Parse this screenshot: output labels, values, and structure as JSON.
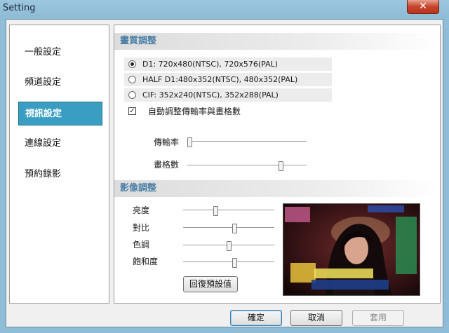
{
  "window": {
    "title": "Setting",
    "close_glyph": "✕"
  },
  "sidebar": {
    "items": [
      {
        "label": "一般設定",
        "active": false
      },
      {
        "label": "頻道設定",
        "active": false
      },
      {
        "label": "視訊設定",
        "active": true
      },
      {
        "label": "連線設定",
        "active": false
      },
      {
        "label": "預約錄影",
        "active": false
      }
    ]
  },
  "quality": {
    "header": "畫質調整",
    "options": [
      {
        "label": "D1: 720x480(NTSC), 720x576(PAL)",
        "selected": true
      },
      {
        "label": "HALF D1:480x352(NTSC), 480x352(PAL)",
        "selected": false
      },
      {
        "label": "CIF: 352x240(NTSC), 352x288(PAL)",
        "selected": false
      }
    ],
    "auto_adjust_label": "自動調整傳輸率與畫格數",
    "auto_adjust_checked": true,
    "auto_adjust_glyph": "✓",
    "sliders": [
      {
        "label": "傳輸率",
        "value": 0.0
      },
      {
        "label": "畫格數",
        "value": 0.8
      }
    ]
  },
  "image": {
    "header": "影像調整",
    "sliders": [
      {
        "label": "亮度",
        "value": 0.35
      },
      {
        "label": "對比",
        "value": 0.57
      },
      {
        "label": "色調",
        "value": 0.5
      },
      {
        "label": "飽和度",
        "value": 0.57
      }
    ],
    "reset_label": "回復預設值",
    "preview_icon": "video-preview-icon"
  },
  "footer": {
    "ok_label": "確定",
    "cancel_label": "取消",
    "apply_label": "套用"
  },
  "colors": {
    "active_nav": "#3a9ec2",
    "section_header_text": "#4b7fa6",
    "close_button": "#c7432a"
  }
}
